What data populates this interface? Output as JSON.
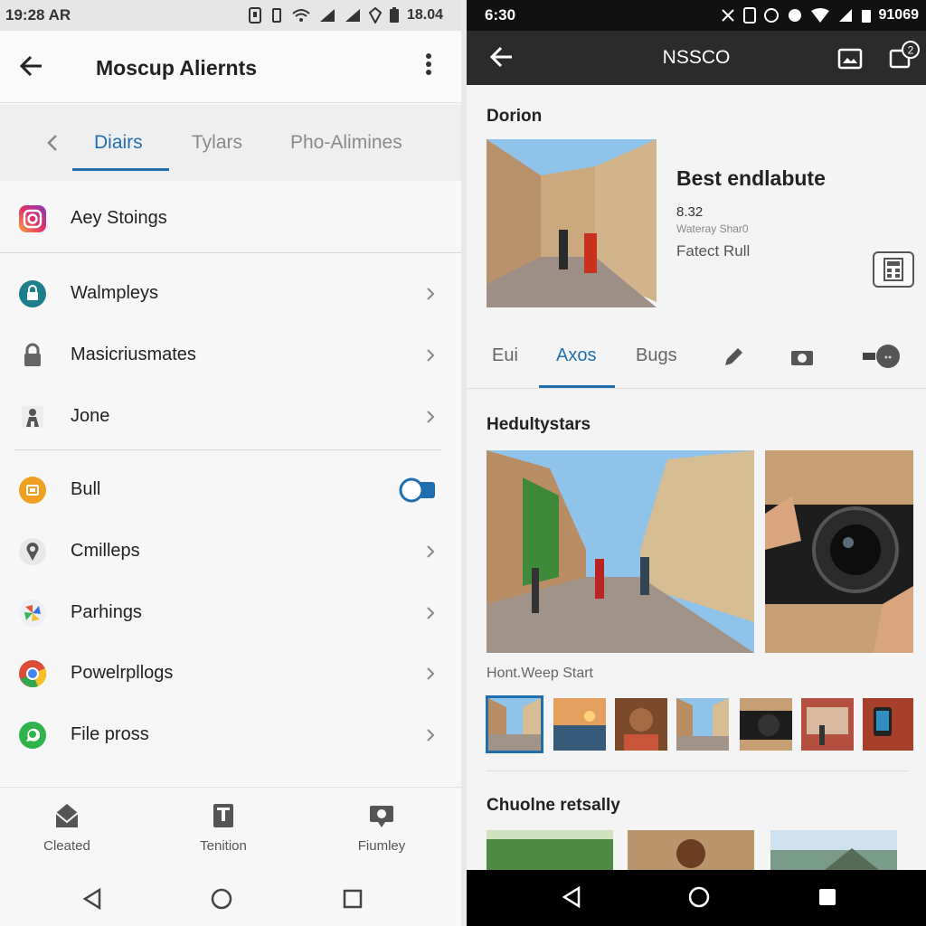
{
  "left": {
    "status": {
      "time": "19:28 AR",
      "clock": "18.04"
    },
    "appbar": {
      "title": "Moscup Aliernts"
    },
    "tabs": [
      "Diairs",
      "Tylars",
      "Pho-Alimines"
    ],
    "items": [
      {
        "label": "Aey Stoings",
        "icon": "instagram-icon",
        "color": "#d6336c"
      },
      {
        "label": "Walmpleys",
        "icon": "lock-badge-icon",
        "color": "#1e7f8c"
      },
      {
        "label": "Masicriusmates",
        "icon": "lock-icon",
        "color": "#666666"
      },
      {
        "label": "Jone",
        "icon": "person-icon",
        "color": "#555555"
      },
      {
        "label": "Bull",
        "icon": "sim-card-icon",
        "color": "#f0a020",
        "toggle": true
      },
      {
        "label": "Cmilleps",
        "icon": "location-pin-icon",
        "color": "#555555"
      },
      {
        "label": "Parhings",
        "icon": "pinwheel-icon",
        "color": "#e25a3a"
      },
      {
        "label": "Powelrpllogs",
        "icon": "chrome-icon",
        "color": "#dd4b39"
      },
      {
        "label": "File pross",
        "icon": "whatsapp-icon",
        "color": "#2fb34a"
      }
    ],
    "bottom_nav": [
      "Cleated",
      "Tenition",
      "Fiumley"
    ]
  },
  "right": {
    "status": {
      "time": "6:30",
      "battery": "91069"
    },
    "appbar": {
      "title": "NSSCO",
      "badge": "2"
    },
    "section1": "Dorion",
    "hero": {
      "title": "Best endlabute",
      "number": "8.32",
      "subtitle": "Wateray Shar0",
      "link": "Fatect Rull"
    },
    "tabs": [
      "Eui",
      "Axos",
      "Bugs"
    ],
    "section2": "Hedultystars",
    "caption": "Hont.Weep Start",
    "section3": "Chuolne retsally",
    "accent": "#1f6fb0"
  }
}
